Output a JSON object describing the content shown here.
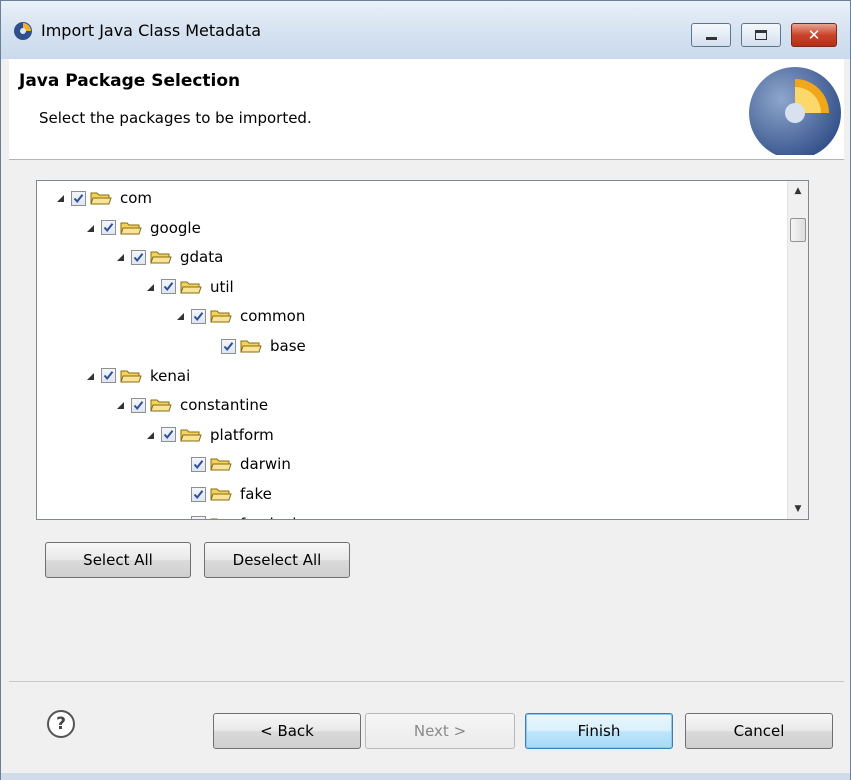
{
  "window": {
    "title": "Import Java Class Metadata",
    "close_glyph": "✕"
  },
  "banner": {
    "title": "Java Package Selection",
    "description": "Select the packages to be imported."
  },
  "tree": {
    "items": [
      {
        "label": "com",
        "depth": 0,
        "expanded": true,
        "checked": true
      },
      {
        "label": "google",
        "depth": 1,
        "expanded": true,
        "checked": true
      },
      {
        "label": "gdata",
        "depth": 2,
        "expanded": true,
        "checked": true
      },
      {
        "label": "util",
        "depth": 3,
        "expanded": true,
        "checked": true
      },
      {
        "label": "common",
        "depth": 4,
        "expanded": true,
        "checked": true
      },
      {
        "label": "base",
        "depth": 5,
        "expanded": false,
        "checked": true
      },
      {
        "label": "kenai",
        "depth": 1,
        "expanded": true,
        "checked": true
      },
      {
        "label": "constantine",
        "depth": 2,
        "expanded": true,
        "checked": true
      },
      {
        "label": "platform",
        "depth": 3,
        "expanded": true,
        "checked": true
      },
      {
        "label": "darwin",
        "depth": 4,
        "expanded": false,
        "checked": true
      },
      {
        "label": "fake",
        "depth": 4,
        "expanded": false,
        "checked": true
      },
      {
        "label": "freebsd",
        "depth": 4,
        "expanded": false,
        "checked": true
      }
    ],
    "scroll_up_glyph": "▲",
    "scroll_down_glyph": "▼"
  },
  "selection_buttons": {
    "select_all": "Select All",
    "deselect_all": "Deselect All"
  },
  "footer": {
    "help_glyph": "?",
    "back": "< Back",
    "next": "Next >",
    "finish": "Finish",
    "cancel": "Cancel"
  },
  "colors": {
    "titlebar": "#d7e3f1",
    "default_button": "#bee6fd",
    "folder": "#f2d35b",
    "check": "#2b4f9a"
  }
}
